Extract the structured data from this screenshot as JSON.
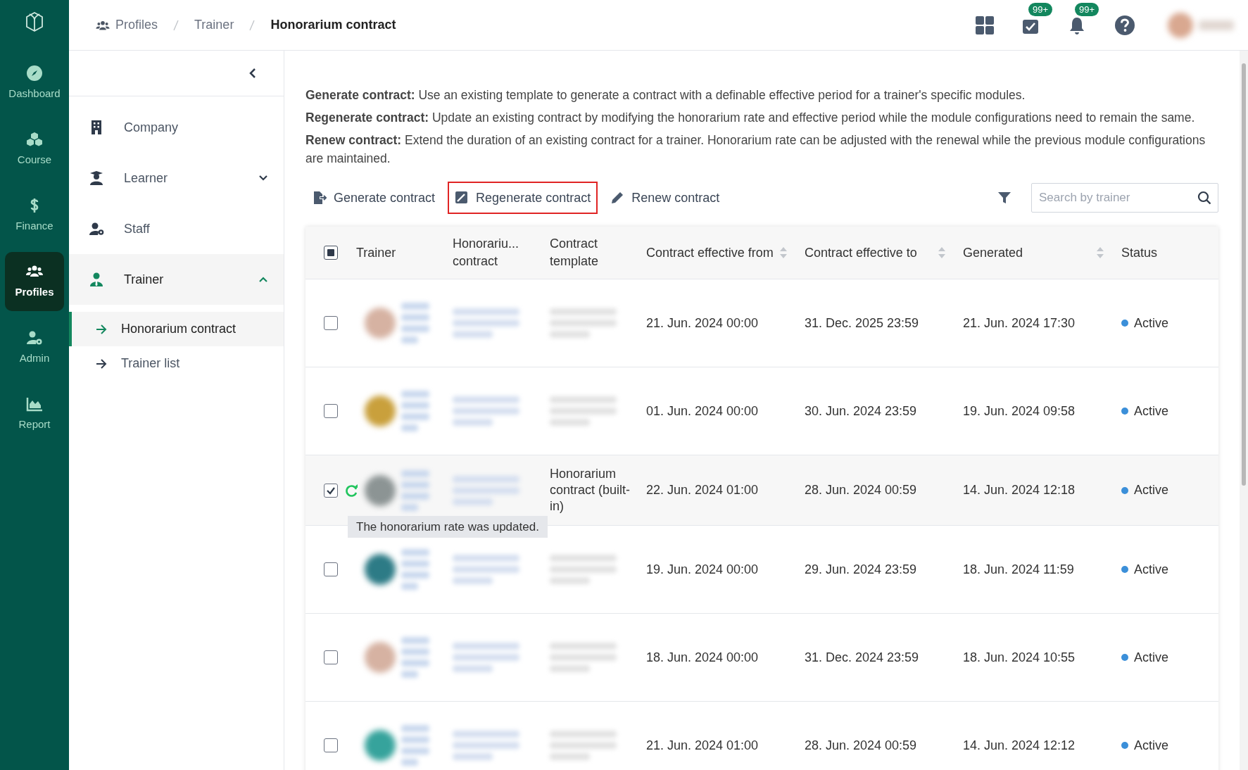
{
  "rail": [
    {
      "label": "Dashboard",
      "selected": false
    },
    {
      "label": "Course",
      "selected": false
    },
    {
      "label": "Finance",
      "selected": false
    },
    {
      "label": "Profiles",
      "selected": true
    },
    {
      "label": "Admin",
      "selected": false
    },
    {
      "label": "Report",
      "selected": false
    }
  ],
  "breadcrumb": [
    "Profiles",
    "Trainer",
    "Honorarium contract"
  ],
  "header_badges": [
    "99+",
    "99+"
  ],
  "sidebar": {
    "items": [
      {
        "label": "Company",
        "selected": false
      },
      {
        "label": "Learner",
        "expanded": false,
        "selected": false
      },
      {
        "label": "Staff",
        "selected": false
      },
      {
        "label": "Trainer",
        "expanded": true,
        "selected": true,
        "children": [
          {
            "label": "Honorarium contract",
            "selected": true
          },
          {
            "label": "Trainer list",
            "selected": false
          }
        ]
      }
    ]
  },
  "descriptions": [
    "**Generate contract:** Use an existing template to generate a contract with a definable effective period for a trainer's specific modules.",
    "**Regenerate contract:** Update an existing contract by modifying the honorarium rate and effective period while the module configurations need to remain the same.",
    "**Renew contract:** Extend the duration of an existing contract for a trainer. Honorarium rate can be adjusted with the renewal while the previous module configurations are maintained."
  ],
  "actions": [
    {
      "label": "Generate contract",
      "focused": false
    },
    {
      "label": "Regenerate contract",
      "focused": true
    },
    {
      "label": "Renew contract",
      "focused": false
    }
  ],
  "search": {
    "placeholder": "Search by trainer"
  },
  "table": {
    "header_checkbox": {
      "checked": false,
      "indeterminate": true
    },
    "columns": [
      {
        "label": "Trainer",
        "sortable": false
      },
      {
        "label": "Honorariu... contract",
        "sortable": false
      },
      {
        "label": "Contract template",
        "sortable": false
      },
      {
        "label": "Contract effective from",
        "sortable": true
      },
      {
        "label": "Contract effective to",
        "sortable": true
      },
      {
        "label": "Generated",
        "sortable": true
      },
      {
        "label": "Status",
        "sortable": false
      }
    ],
    "rows": [
      {
        "selected": false,
        "color": "#d6b2a2",
        "from": "21. Jun. 2024 00:00",
        "to": "31. Dec. 2025 23:59",
        "generated": "21. Jun. 2024 17:30",
        "status": "Active"
      },
      {
        "selected": false,
        "color": "#c9a03c",
        "from": "01. Jun. 2024 00:00",
        "to": "30. Jun. 2024 23:59",
        "generated": "19. Jun. 2024 09:58",
        "status": "Active"
      },
      {
        "selected": true,
        "color": "#8c9494",
        "template": "Honorarium contract (built-in)",
        "updated": true,
        "tooltip": "The honorarium rate was updated.",
        "from": "22. Jun. 2024 01:00",
        "to": "28. Jun. 2024 00:59",
        "generated": "14. Jun. 2024 12:18",
        "status": "Active"
      },
      {
        "selected": false,
        "color": "#2d7b86",
        "from": "19. Jun. 2024 00:00",
        "to": "29. Jun. 2024 23:59",
        "generated": "18. Jun. 2024 11:59",
        "status": "Active"
      },
      {
        "selected": false,
        "color": "#d6b2a2",
        "from": "18. Jun. 2024 00:00",
        "to": "31. Dec. 2024 23:59",
        "generated": "18. Jun. 2024 10:55",
        "status": "Active"
      },
      {
        "selected": false,
        "color": "#36a39c",
        "from": "21. Jun. 2024 01:00",
        "to": "28. Jun. 2024 00:59",
        "generated": "14. Jun. 2024 12:12",
        "status": "Active"
      }
    ]
  }
}
